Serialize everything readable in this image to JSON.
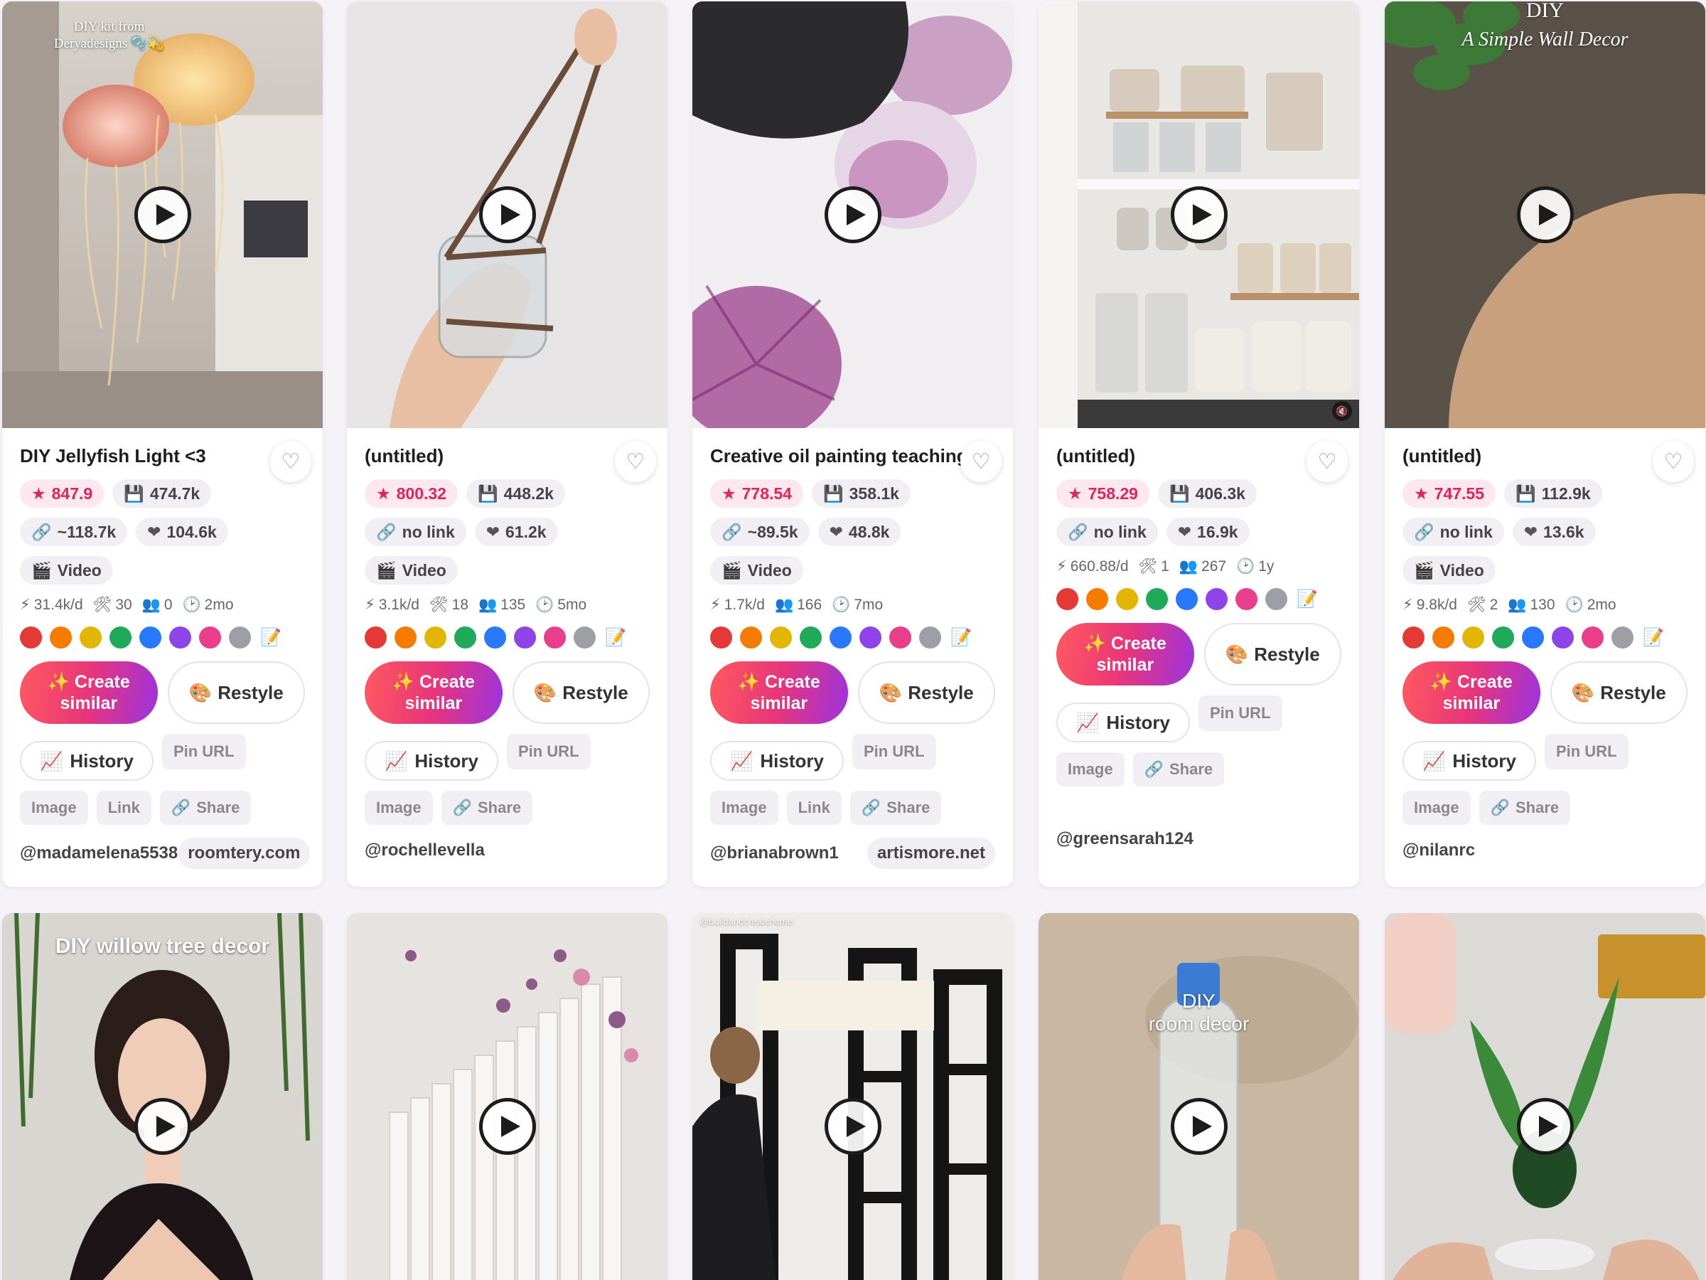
{
  "palette": [
    "#e53935",
    "#f57c00",
    "#e3b505",
    "#1faa59",
    "#2979ff",
    "#8e44e8",
    "#e83e8c",
    "#9e9ea6"
  ],
  "cards": [
    {
      "overlay": "DIY kit from\nDeryadesigns 🫧💫",
      "title": "DIY Jellyfish Light <3",
      "score": "847.9",
      "saves": "474.7k",
      "links": "~118.7k",
      "likes": "104.6k",
      "type": "Video",
      "rate": "31.4k/d",
      "tools": "30",
      "people": "0",
      "age": "2mo",
      "create": "Create similar",
      "restyle": "Restyle",
      "history": "History",
      "pin_url": "Pin URL",
      "image": "Image",
      "link": "Link",
      "share": "Share",
      "handle": "@madamelena5538",
      "domain": "roomtery.com"
    },
    {
      "title": "(untitled)",
      "score": "800.32",
      "saves": "448.2k",
      "links": "no link",
      "likes": "61.2k",
      "type": "Video",
      "rate": "3.1k/d",
      "tools": "18",
      "people": "135",
      "age": "5mo",
      "create": "Create similar",
      "restyle": "Restyle",
      "history": "History",
      "pin_url": "Pin URL",
      "image": "Image",
      "share": "Share",
      "handle": "@rochellevella"
    },
    {
      "title": "Creative oil painting teaching",
      "score": "778.54",
      "saves": "358.1k",
      "links": "~89.5k",
      "likes": "48.8k",
      "type": "Video",
      "rate": "1.7k/d",
      "people": "166",
      "age": "7mo",
      "create": "Create similar",
      "restyle": "Restyle",
      "history": "History",
      "pin_url": "Pin URL",
      "image": "Image",
      "link": "Link",
      "share": "Share",
      "handle": "@brianabrown1",
      "domain": "artismore.net"
    },
    {
      "title": "(untitled)",
      "score": "758.29",
      "saves": "406.3k",
      "links": "no link",
      "likes": "16.9k",
      "rate": "660.88/d",
      "tools": "1",
      "people": "267",
      "age": "1y",
      "create": "Create similar",
      "restyle": "Restyle",
      "history": "History",
      "pin_url": "Pin URL",
      "image": "Image",
      "share": "Share",
      "handle": "@greensarah124"
    },
    {
      "overlay_top": "DIY",
      "overlay": "A Simple Wall Decor",
      "title": "(untitled)",
      "score": "747.55",
      "saves": "112.9k",
      "links": "no link",
      "likes": "13.6k",
      "type": "Video",
      "rate": "9.8k/d",
      "tools": "2",
      "people": "130",
      "age": "2mo",
      "create": "Create similar",
      "restyle": "Restyle",
      "history": "History",
      "pin_url": "Pin URL",
      "image": "Image",
      "share": "Share",
      "handle": "@nilanrc"
    }
  ],
  "row2": [
    {
      "overlay": "DIY willow tree decor"
    },
    {},
    {
      "overlay": "@buildandcreatehome"
    },
    {
      "overlay": "DIY\nroom decor"
    },
    {}
  ]
}
